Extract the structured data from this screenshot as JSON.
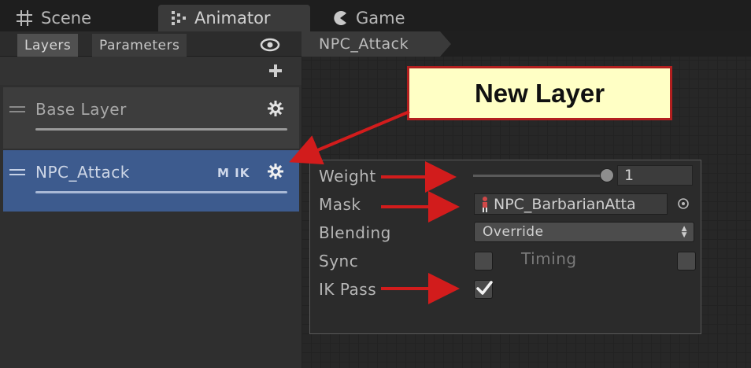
{
  "window_tabs": [
    {
      "label": "Scene",
      "icon": "grid-icon"
    },
    {
      "label": "Animator",
      "icon": "animator-icon"
    },
    {
      "label": "Game",
      "icon": "pacman-icon"
    }
  ],
  "panel_tabs": [
    "Layers",
    "Parameters"
  ],
  "layers": [
    {
      "name": "Base Layer",
      "badges": ""
    },
    {
      "name": "NPC_Attack",
      "badges": "M IK"
    }
  ],
  "breadcrumb": "NPC_Attack",
  "layer_settings": {
    "weight_label": "Weight",
    "weight_value": "1",
    "weight_fraction": 1.0,
    "mask_label": "Mask",
    "mask_value": "NPC_BarbarianAtta",
    "blending_label": "Blending",
    "blending_value": "Override",
    "sync_label": "Sync",
    "sync_checked": false,
    "timing_label": "Timing",
    "timing_checked": false,
    "ikpass_label": "IK Pass",
    "ikpass_checked": true
  },
  "annotation": {
    "text": "New Layer"
  },
  "colors": {
    "selected_layer": "#3d5b8e",
    "callout_bg": "#ffffc5",
    "arrow_red": "#d21c1c"
  }
}
